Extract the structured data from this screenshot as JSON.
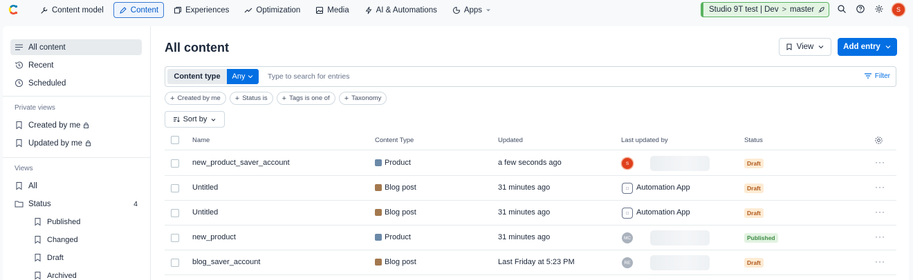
{
  "topnav": {
    "items": [
      {
        "label": "Content model",
        "icon": "wrench-icon",
        "active": false
      },
      {
        "label": "Content",
        "icon": "pencil-icon",
        "active": true
      },
      {
        "label": "Experiences",
        "icon": "layers-icon",
        "active": false
      },
      {
        "label": "Optimization",
        "icon": "trend-icon",
        "active": false
      },
      {
        "label": "Media",
        "icon": "image-icon",
        "active": false
      },
      {
        "label": "AI & Automations",
        "icon": "bolt-icon",
        "active": false
      },
      {
        "label": "Apps",
        "icon": "puzzle-icon",
        "active": false
      }
    ],
    "environment": {
      "space": "Studio 9T test | Dev",
      "separator": ">",
      "env": "master"
    },
    "avatar_initial": "S"
  },
  "sidebar": {
    "items": [
      {
        "label": "All content",
        "icon": "list-icon"
      },
      {
        "label": "Recent",
        "icon": "history-icon"
      },
      {
        "label": "Scheduled",
        "icon": "clock-icon"
      }
    ],
    "private_heading": "Private views",
    "private_items": [
      {
        "label": "Created by me"
      },
      {
        "label": "Updated by me"
      }
    ],
    "views_heading": "Views",
    "views": [
      {
        "label": "All"
      },
      {
        "label": "Status",
        "count": "4"
      }
    ],
    "status_views": [
      {
        "label": "Published"
      },
      {
        "label": "Changed"
      },
      {
        "label": "Draft"
      },
      {
        "label": "Archived"
      }
    ]
  },
  "main": {
    "title": "All content",
    "view_button": "View",
    "add_button": "Add entry",
    "search": {
      "content_type_label": "Content type",
      "content_type_value": "Any",
      "placeholder": "Type to search for entries",
      "filter_label": "Filter"
    },
    "chips": [
      "Created by me",
      "Status is",
      "Tags is one of",
      "Taxonomy"
    ],
    "sort_label": "Sort by",
    "columns": [
      "Name",
      "Content Type",
      "Updated",
      "Last updated by",
      "Status"
    ],
    "rows": [
      {
        "name": "new_product_saver_account",
        "content_type": "Product",
        "ct_kind": "product",
        "updated": "a few seconds ago",
        "updated_by": "",
        "updater_kind": "user-red",
        "avatar_text": "S",
        "status": "Draft",
        "status_kind": "draft"
      },
      {
        "name": "Untitled",
        "content_type": "Blog post",
        "ct_kind": "blog",
        "updated": "31 minutes ago",
        "updated_by": "Automation App",
        "updater_kind": "app",
        "avatar_text": "",
        "status": "Draft",
        "status_kind": "draft"
      },
      {
        "name": "Untitled",
        "content_type": "Blog post",
        "ct_kind": "blog",
        "updated": "31 minutes ago",
        "updated_by": "Automation App",
        "updater_kind": "app",
        "avatar_text": "",
        "status": "Draft",
        "status_kind": "draft"
      },
      {
        "name": "new_product",
        "content_type": "Product",
        "ct_kind": "product",
        "updated": "31 minutes ago",
        "updated_by": "",
        "updater_kind": "user-grey",
        "avatar_text": "MC",
        "status": "Published",
        "status_kind": "published"
      },
      {
        "name": "blog_saver_account",
        "content_type": "Blog post",
        "ct_kind": "blog",
        "updated": "Last Friday at 5:23 PM",
        "updated_by": "",
        "updater_kind": "user-grey",
        "avatar_text": "RE",
        "status": "Draft",
        "status_kind": "draft"
      }
    ],
    "row_more": "···"
  }
}
